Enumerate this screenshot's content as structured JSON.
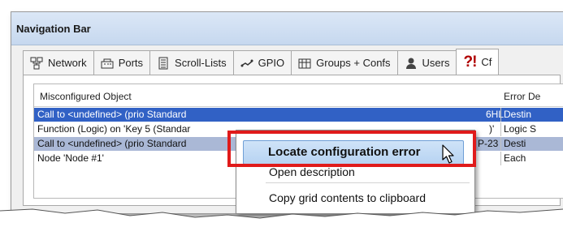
{
  "window": {
    "title": "Navigation Bar"
  },
  "tabs": [
    {
      "label": "Network",
      "icon": "network-icon"
    },
    {
      "label": "Ports",
      "icon": "ports-icon"
    },
    {
      "label": "Scroll-Lists",
      "icon": "scroll-lists-icon"
    },
    {
      "label": "GPIO",
      "icon": "gpio-icon"
    },
    {
      "label": "Groups + Confs",
      "icon": "groups-icon"
    },
    {
      "label": "Users",
      "icon": "users-icon"
    },
    {
      "label": "Cf",
      "icon": "config-error-icon",
      "active": true
    }
  ],
  "grid": {
    "columns": [
      "Misconfigured Object",
      "Error De"
    ],
    "rows": [
      {
        "object": "Call to <undefined> (prio Standard",
        "object_tail": "6HL",
        "error": "Destin",
        "selected": true
      },
      {
        "object": "Function (Logic) on 'Key 5 (Standar",
        "object_tail": ")'",
        "error": "Logic S"
      },
      {
        "object": "Call to <undefined> (prio Standard",
        "object_tail": "P-23",
        "error": "Desti",
        "selected_inactive": true
      },
      {
        "object": "Node 'Node #1'",
        "object_tail": "",
        "error": "Each"
      }
    ]
  },
  "context_menu": {
    "items": [
      {
        "label": "Locate configuration error",
        "highlighted": true
      },
      {
        "label": "Open description"
      },
      {
        "label": "Copy grid contents to clipboard"
      }
    ]
  },
  "colors": {
    "highlight_frame": "#e01b1b",
    "selection": "#3161c5",
    "title_bar": "#c6d8ef"
  }
}
